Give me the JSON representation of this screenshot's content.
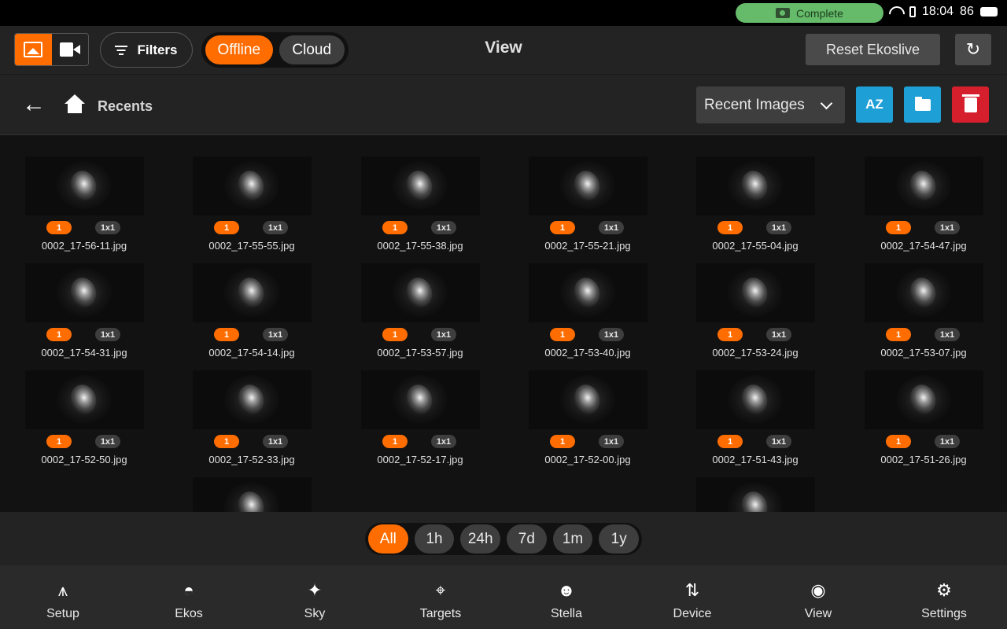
{
  "statusbar": {
    "status_text": "Complete",
    "clock": "18:04",
    "battery": "86"
  },
  "toolbar": {
    "filters_label": "Filters",
    "offline_label": "Offline",
    "cloud_label": "Cloud",
    "title": "View",
    "reset_label": "Reset Ekoslive"
  },
  "navrow": {
    "breadcrumb": "Recents",
    "sort_value": "Recent Images",
    "sort_az_label": "AZ"
  },
  "images": [
    {
      "file": "0002_17-56-11.jpg",
      "count": "1",
      "binning": "1x1"
    },
    {
      "file": "0002_17-55-55.jpg",
      "count": "1",
      "binning": "1x1"
    },
    {
      "file": "0002_17-55-38.jpg",
      "count": "1",
      "binning": "1x1"
    },
    {
      "file": "0002_17-55-21.jpg",
      "count": "1",
      "binning": "1x1"
    },
    {
      "file": "0002_17-55-04.jpg",
      "count": "1",
      "binning": "1x1"
    },
    {
      "file": "0002_17-54-47.jpg",
      "count": "1",
      "binning": "1x1"
    },
    {
      "file": "0002_17-54-31.jpg",
      "count": "1",
      "binning": "1x1"
    },
    {
      "file": "0002_17-54-14.jpg",
      "count": "1",
      "binning": "1x1"
    },
    {
      "file": "0002_17-53-57.jpg",
      "count": "1",
      "binning": "1x1"
    },
    {
      "file": "0002_17-53-40.jpg",
      "count": "1",
      "binning": "1x1"
    },
    {
      "file": "0002_17-53-24.jpg",
      "count": "1",
      "binning": "1x1"
    },
    {
      "file": "0002_17-53-07.jpg",
      "count": "1",
      "binning": "1x1"
    },
    {
      "file": "0002_17-52-50.jpg",
      "count": "1",
      "binning": "1x1"
    },
    {
      "file": "0002_17-52-33.jpg",
      "count": "1",
      "binning": "1x1"
    },
    {
      "file": "0002_17-52-17.jpg",
      "count": "1",
      "binning": "1x1"
    },
    {
      "file": "0002_17-52-00.jpg",
      "count": "1",
      "binning": "1x1"
    },
    {
      "file": "0002_17-51-43.jpg",
      "count": "1",
      "binning": "1x1"
    },
    {
      "file": "0002_17-51-26.jpg",
      "count": "1",
      "binning": "1x1"
    }
  ],
  "time_filters": [
    "All",
    "1h",
    "24h",
    "7d",
    "1m",
    "1y"
  ],
  "time_filter_selected": "All",
  "bottom_nav": [
    {
      "label": "Setup",
      "icon": "setup-icon"
    },
    {
      "label": "Ekos",
      "icon": "observatory-dome-icon"
    },
    {
      "label": "Sky",
      "icon": "sparkles-icon"
    },
    {
      "label": "Targets",
      "icon": "crosshair-icon"
    },
    {
      "label": "Stella",
      "icon": "assistant-head-icon"
    },
    {
      "label": "Device",
      "icon": "up-down-arrows-icon"
    },
    {
      "label": "View",
      "icon": "eye-icon"
    },
    {
      "label": "Settings",
      "icon": "gear-icon"
    }
  ],
  "colors": {
    "accent": "#ff6d00",
    "status_ok": "#66bb6a",
    "action_blue": "#1e9fd6",
    "danger": "#d61f2c"
  }
}
